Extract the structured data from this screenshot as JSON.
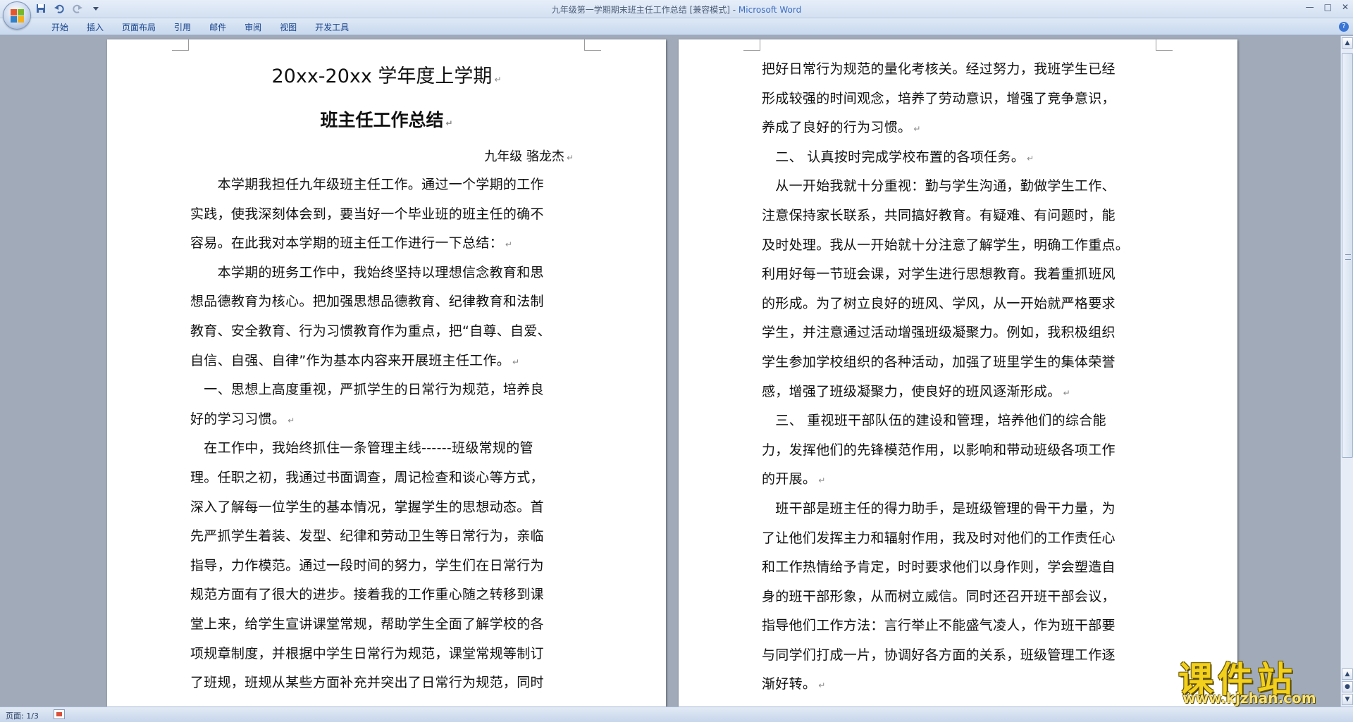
{
  "window": {
    "title": "九年级第一学期期末班主任工作总结 [兼容模式] - ",
    "app_name": "Microsoft Word",
    "controls": [
      "—",
      "□",
      "✕"
    ]
  },
  "quick_access": {
    "icons": [
      "save-icon",
      "undo-icon",
      "redo-icon",
      "customize-icon"
    ]
  },
  "ribbon": {
    "tabs": [
      "开始",
      "插入",
      "页面布局",
      "引用",
      "邮件",
      "审阅",
      "视图",
      "开发工具"
    ]
  },
  "page1": {
    "title": "20xx-20xx 学年度上学期",
    "subtitle": "班主任工作总结",
    "author": "九年级    骆龙杰",
    "lines": [
      {
        "t": "　　本学期我担任九年级班主任工作。通过一个学期的工作",
        "m": false
      },
      {
        "t": "实践，使我深刻体会到，要当好一个毕业班的班主任的确不",
        "m": false
      },
      {
        "t": "容易。在此我对本学期的班主任工作进行一下总结：",
        "m": true
      },
      {
        "t": "　　本学期的班务工作中，我始终坚持以理想信念教育和思",
        "m": false
      },
      {
        "t": "想品德教育为核心。把加强思想品德教育、纪律教育和法制",
        "m": false
      },
      {
        "t": "教育、安全教育、行为习惯教育作为重点，把“自尊、自爱、",
        "m": false
      },
      {
        "t": "自信、自强、自律”作为基本内容来开展班主任工作。",
        "m": true
      },
      {
        "t": "　一、思想上高度重视，严抓学生的日常行为规范，培养良",
        "m": false
      },
      {
        "t": "好的学习习惯。",
        "m": true
      },
      {
        "t": "　在工作中，我始终抓住一条管理主线------班级常规的管",
        "m": false
      },
      {
        "t": "理。任职之初，我通过书面调查，周记检查和谈心等方式，",
        "m": false
      },
      {
        "t": "深入了解每一位学生的基本情况，掌握学生的思想动态。首",
        "m": false
      },
      {
        "t": "先严抓学生着装、发型、纪律和劳动卫生等日常行为，亲临",
        "m": false
      },
      {
        "t": "指导，力作模范。通过一段时间的努力，学生们在日常行为",
        "m": false
      },
      {
        "t": "规范方面有了很大的进步。接着我的工作重心随之转移到课",
        "m": false
      },
      {
        "t": "堂上来，给学生宣讲课堂常规，帮助学生全面了解学校的各",
        "m": false
      },
      {
        "t": "项规章制度，并根据中学生日常行为规范，课堂常规等制订",
        "m": false
      },
      {
        "t": "了班规，班规从某些方面补充并突出了日常行为规范，同时",
        "m": false
      }
    ]
  },
  "page2": {
    "lines": [
      {
        "t": "把好日常行为规范的量化考核关。经过努力，我班学生已经",
        "m": false
      },
      {
        "t": "形成较强的时间观念，培养了劳动意识，增强了竞争意识，",
        "m": false
      },
      {
        "t": "养成了良好的行为习惯。",
        "m": true
      },
      {
        "t": "　二、 认真按时完成学校布置的各项任务。",
        "m": true
      },
      {
        "t": "　从一开始我就十分重视：勤与学生沟通，勤做学生工作、",
        "m": false
      },
      {
        "t": "注意保持家长联系，共同搞好教育。有疑难、有问题时，能",
        "m": false
      },
      {
        "t": "及时处理。我从一开始就十分注意了解学生，明确工作重点。",
        "m": false
      },
      {
        "t": "利用好每一节班会课，对学生进行思想教育。我着重抓班风",
        "m": false
      },
      {
        "t": "的形成。为了树立良好的班风、学风，从一开始就严格要求",
        "m": false
      },
      {
        "t": "学生，并注意通过活动增强班级凝聚力。例如，我积极组织",
        "m": false
      },
      {
        "t": "学生参加学校组织的各种活动，加强了班里学生的集体荣誉",
        "m": false
      },
      {
        "t": "感，增强了班级凝聚力，使良好的班风逐渐形成。",
        "m": true
      },
      {
        "t": "　三、 重视班干部队伍的建设和管理，培养他们的综合能",
        "m": false
      },
      {
        "t": "力，发挥他们的先锋模范作用，以影响和带动班级各项工作",
        "m": false
      },
      {
        "t": "的开展。",
        "m": true
      },
      {
        "t": "　班干部是班主任的得力助手，是班级管理的骨干力量，为",
        "m": false
      },
      {
        "t": "了让他们发挥主力和辐射作用，我及时对他们的工作责任心",
        "m": false
      },
      {
        "t": "和工作热情给予肯定，时时要求他们以身作则，学会塑造自",
        "m": false
      },
      {
        "t": "身的班干部形象，从而树立威信。同时还召开班干部会议，",
        "m": false
      },
      {
        "t": "指导他们工作方法：言行举止不能盛气凌人，作为班干部要",
        "m": false
      },
      {
        "t": "与同学们打成一片，协调好各方面的关系，班级管理工作逐",
        "m": false
      },
      {
        "t": "渐好转。",
        "m": true
      }
    ]
  },
  "paragraph_mark": "↵",
  "statusbar": {
    "page_info": "页面: 1/3"
  },
  "watermark": {
    "text": "课件站",
    "url": "www.kjzhan.com"
  },
  "colors": {
    "accent": "#15428b",
    "app_name": "#3b6cc4",
    "doc_background": "#a0aab9",
    "watermark": "#f2d01c"
  }
}
